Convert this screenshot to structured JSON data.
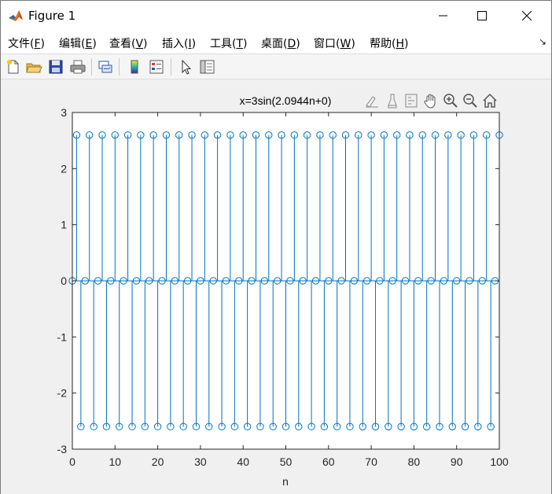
{
  "window": {
    "title": "Figure 1",
    "controls": {
      "minimize": "minimize",
      "maximize": "maximize",
      "close": "close"
    }
  },
  "menu": [
    {
      "label": "文件(",
      "key": "F",
      "suffix": ")"
    },
    {
      "label": "编辑(",
      "key": "E",
      "suffix": ")"
    },
    {
      "label": "查看(",
      "key": "V",
      "suffix": ")"
    },
    {
      "label": "插入(",
      "key": "I",
      "suffix": ")"
    },
    {
      "label": "工具(",
      "key": "T",
      "suffix": ")"
    },
    {
      "label": "桌面(",
      "key": "D",
      "suffix": ")"
    },
    {
      "label": "窗口(",
      "key": "W",
      "suffix": ")"
    },
    {
      "label": "帮助(",
      "key": "H",
      "suffix": ")"
    }
  ],
  "toolbar": {
    "buttons": [
      "new-figure-icon",
      "open-file-icon",
      "save-icon",
      "print-icon",
      "link-plot-icon",
      "colorbar-icon",
      "legend-icon",
      "pointer-icon",
      "property-inspector-icon"
    ]
  },
  "axes_toolbar": {
    "buttons": [
      "brush-icon",
      "data-tips-icon",
      "restore-view-icon",
      "pan-icon",
      "zoom-in-icon",
      "zoom-out-icon",
      "home-icon"
    ]
  },
  "colors": {
    "stem": "#0072bd",
    "axis": "#262626",
    "background": "#ffffff",
    "figure": "#f0f0f0"
  },
  "chart_data": {
    "type": "stem",
    "title": "x=3sin(2.0944n+0)",
    "xlabel": "n",
    "ylabel": "",
    "xlim": [
      0,
      100
    ],
    "ylim": [
      -3,
      3
    ],
    "xticks": [
      0,
      10,
      20,
      30,
      40,
      50,
      60,
      70,
      80,
      90,
      100
    ],
    "yticks": [
      -3,
      -2,
      -1,
      0,
      1,
      2,
      3
    ],
    "grid": false,
    "amplitude": 3,
    "omega": 2.0944,
    "phase": 0,
    "n_start": 0,
    "n_end": 100
  }
}
